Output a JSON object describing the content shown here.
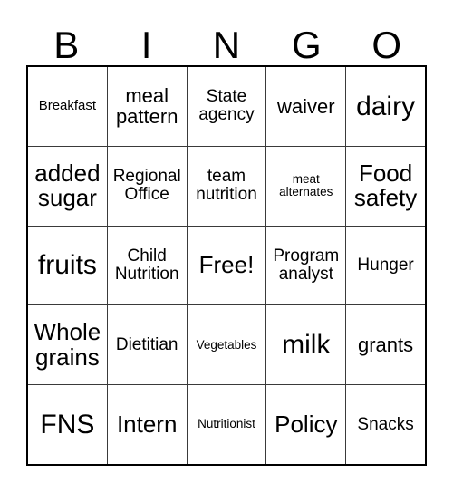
{
  "card": {
    "headers": [
      "B",
      "I",
      "N",
      "G",
      "O"
    ],
    "free_space_label": "Free!",
    "grid_line_color": "#3a3a3a",
    "border_color": "#000000",
    "background_color": "#ffffff",
    "text_color": "#000000",
    "rows": [
      [
        {
          "label": "Breakfast",
          "size": "sm"
        },
        {
          "label": "meal pattern",
          "size": "lg"
        },
        {
          "label": "State agency",
          "size": "md"
        },
        {
          "label": "waiver",
          "size": "lg"
        },
        {
          "label": "dairy",
          "size": "xxl"
        }
      ],
      [
        {
          "label": "added sugar",
          "size": "xl"
        },
        {
          "label": "Regional Office",
          "size": "md"
        },
        {
          "label": "team nutrition",
          "size": "md"
        },
        {
          "label": "meat alternates",
          "size": "xs"
        },
        {
          "label": "Food safety",
          "size": "xl"
        }
      ],
      [
        {
          "label": "fruits",
          "size": "xxl"
        },
        {
          "label": "Child Nutrition",
          "size": "md"
        },
        {
          "label": "Free!",
          "size": "xl"
        },
        {
          "label": "Program analyst",
          "size": "md"
        },
        {
          "label": "Hunger",
          "size": "md"
        }
      ],
      [
        {
          "label": "Whole grains",
          "size": "xl"
        },
        {
          "label": "Dietitian",
          "size": "md"
        },
        {
          "label": "Vegetables",
          "size": "xs"
        },
        {
          "label": "milk",
          "size": "xxl"
        },
        {
          "label": "grants",
          "size": "lg"
        }
      ],
      [
        {
          "label": "FNS",
          "size": "xxl"
        },
        {
          "label": "Intern",
          "size": "xl"
        },
        {
          "label": "Nutritionist",
          "size": "xs"
        },
        {
          "label": "Policy",
          "size": "xl"
        },
        {
          "label": "Snacks",
          "size": "md"
        }
      ]
    ]
  }
}
